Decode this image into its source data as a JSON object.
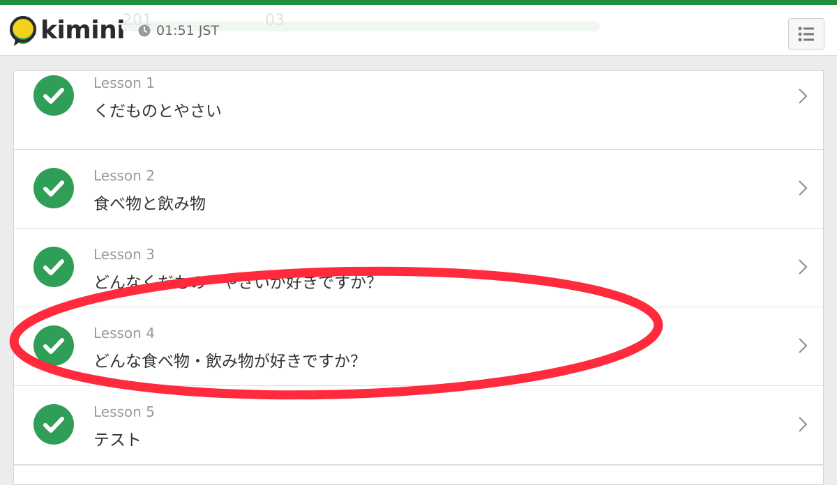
{
  "header": {
    "logo_text": "kimini",
    "time": "01:51 JST",
    "ghost_left": "201",
    "ghost_right": "03",
    "menu_icon": "list-icon"
  },
  "lessons": [
    {
      "number": "Lesson 1",
      "title": "くだものとやさい",
      "status": "completed"
    },
    {
      "number": "Lesson 2",
      "title": "食べ物と飲み物",
      "status": "completed"
    },
    {
      "number": "Lesson 3",
      "title": "どんなくだもの・やさいが好きですか？",
      "status": "completed"
    },
    {
      "number": "Lesson 4",
      "title": "どんな食べ物・飲み物が好きですか？",
      "status": "completed"
    },
    {
      "number": "Lesson 5",
      "title": "テスト",
      "status": "completed"
    }
  ],
  "colors": {
    "brand_green": "#1e8f3a",
    "check_green": "#2f9e57",
    "highlight_red": "#ff2a3c",
    "logo_yellow": "#f2d21b"
  }
}
